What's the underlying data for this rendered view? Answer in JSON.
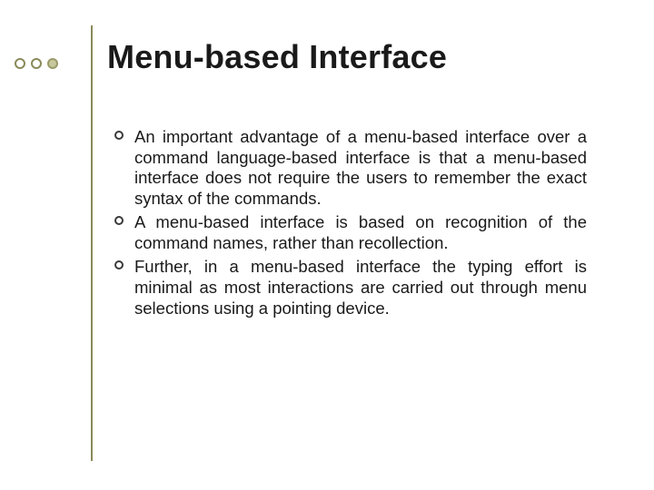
{
  "slide": {
    "title": "Menu-based Interface",
    "bullets": [
      "An important advantage of a menu-based interface over a command language-based interface is that a menu-based interface does not require the users to remember the exact syntax of the commands.",
      "A menu-based interface is based on recognition of the command names, rather than recollection.",
      "Further, in a menu-based interface the typing effort is minimal as most interactions are carried out through menu selections using a pointing device."
    ]
  }
}
